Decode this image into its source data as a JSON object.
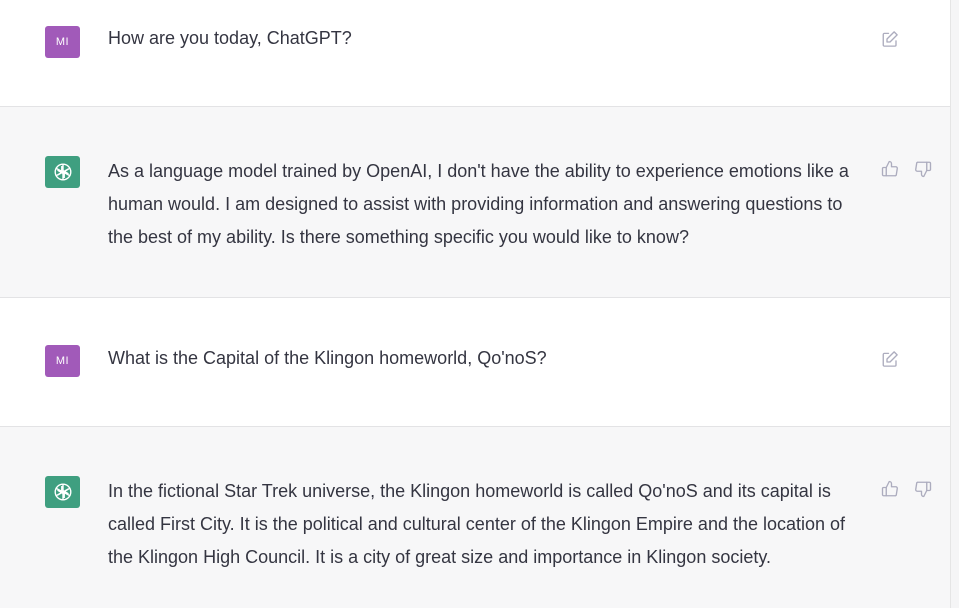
{
  "conversation": [
    {
      "role": "user",
      "avatar_initials": "MI",
      "text": "How are you today, ChatGPT?",
      "action_icon": "edit-icon"
    },
    {
      "role": "assistant",
      "avatar_icon": "openai-logo-icon",
      "text": "As a language model trained by OpenAI, I don't have the ability to experience emotions like a human would. I am designed to assist with providing information and answering questions to the best of my ability. Is there something specific you would like to know?",
      "action_icons": [
        "thumbs-up-icon",
        "thumbs-down-icon"
      ]
    },
    {
      "role": "user",
      "avatar_initials": "MI",
      "text": "What is the Capital of the Klingon homeworld, Qo'noS?",
      "action_icon": "edit-icon"
    },
    {
      "role": "assistant",
      "avatar_icon": "openai-logo-icon",
      "text": "In the fictional Star Trek universe, the Klingon homeworld is called Qo'noS and its capital is called First City. It is the political and cultural center of the Klingon Empire and the location of the Klingon High Council. It is a city of great size and importance in Klingon society.",
      "action_icons": [
        "thumbs-up-icon",
        "thumbs-down-icon"
      ]
    }
  ],
  "colors": {
    "user_avatar": "#a15ab9",
    "assistant_avatar": "#3f9f80",
    "assistant_row_bg": "#f7f7f8",
    "text": "#343541",
    "icon": "#acacbe"
  }
}
